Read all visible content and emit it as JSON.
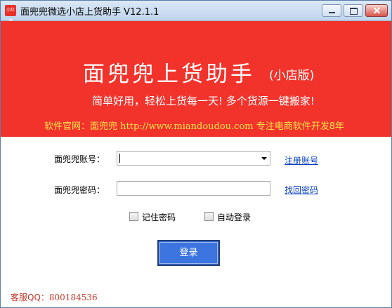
{
  "window": {
    "title": "面兜兜微选小店上货助手 V12.1.1",
    "app_icon_text": "小红书"
  },
  "banner": {
    "title": "面兜兜上货助手",
    "edition": "(小店版)",
    "slogan": "简单好用，轻松上货每一天! 多个货源一键搬家!",
    "site_prefix": "软件官网：面兜兜 ",
    "site_url": "http://www.miandoudou.com",
    "site_suffix": " 专注电商软件开发8年",
    "colors": {
      "background": "#f1332c",
      "text": "#ffffff",
      "highlight": "#ffe34a"
    }
  },
  "form": {
    "account_label": "面兜兜账号：",
    "account_value": "",
    "register_link": "注册账号",
    "password_label": "面兜兜密码：",
    "password_value": "",
    "recover_link": "找回密码",
    "remember_label": "记住密码",
    "remember_checked": false,
    "autologin_label": "自动登录",
    "autologin_checked": false,
    "login_button": "登录"
  },
  "footer": {
    "service_label": "客服QQ：",
    "service_qq": "800184536"
  }
}
